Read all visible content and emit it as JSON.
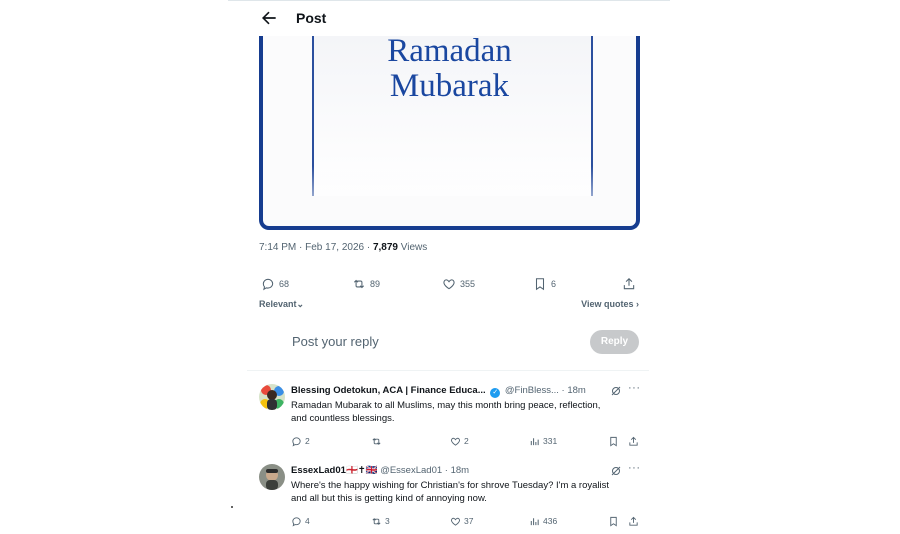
{
  "header": {
    "title": "Post"
  },
  "media": {
    "line1": "Ramadan",
    "line2": "Mubarak"
  },
  "meta": {
    "time": "7:14 PM · Feb 17, 2026 · ",
    "views_count": "7,879",
    "views_label": " Views"
  },
  "actions": {
    "replies": "68",
    "reposts": "89",
    "likes": "355",
    "bookmarks": "6"
  },
  "filter": {
    "relevant_label": "Relevant",
    "view_quotes_label": "View quotes"
  },
  "reply_box": {
    "placeholder": "Post your reply",
    "button_label": "Reply"
  },
  "replies": [
    {
      "name": "Blessing Odetokun, ACA | Finance Educa...",
      "handle": "@FinBless...",
      "time": "18m",
      "text_line1": "Ramadan Mubarak to all Muslims, may this month bring peace, reflection,",
      "text_line2": "and countless blessings.",
      "reply_count": "2",
      "repost_count": "",
      "like_count": "2",
      "view_count": "331"
    },
    {
      "name": "EssexLad01",
      "flags": "🏴󠁧󠁢󠁥󠁮󠁧󠁿✝🇬🇧",
      "handle": "@EssexLad01",
      "time": "18m",
      "text_line1": "Where's the happy wishing for Christian's for shrove Tuesday? I'm a royalist",
      "text_line2": "and all but this is getting kind of annoying now.",
      "reply_count": "4",
      "repost_count": "3",
      "like_count": "37",
      "view_count": "436"
    }
  ]
}
